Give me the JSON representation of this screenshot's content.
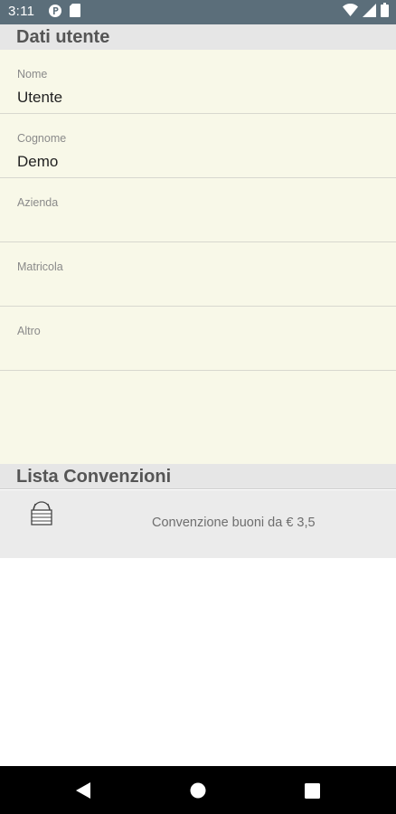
{
  "status_bar": {
    "time": "3:11",
    "icons": [
      "notification-p-icon",
      "sim-card-icon",
      "wifi-icon",
      "cellular-signal-icon",
      "battery-icon"
    ]
  },
  "user_section": {
    "title": "Dati utente",
    "fields": [
      {
        "label": "Nome",
        "value": "Utente"
      },
      {
        "label": "Cognome",
        "value": "Demo"
      },
      {
        "label": "Azienda",
        "value": ""
      },
      {
        "label": "Matricola",
        "value": ""
      },
      {
        "label": "Altro",
        "value": ""
      }
    ]
  },
  "conventions_section": {
    "title": "Lista Convenzioni",
    "items": [
      {
        "icon": "voucher-stack-icon",
        "text": "Convenzione buoni da € 3,5"
      }
    ]
  },
  "nav_bar": {
    "buttons": [
      "back-icon",
      "home-icon",
      "recents-icon"
    ]
  },
  "colors": {
    "status_bar": "#5b6e7a",
    "section_header": "#e6e6e6",
    "user_panel": "#f8f8e8",
    "conv_panel": "#ebebeb",
    "nav_bar": "#000000"
  }
}
